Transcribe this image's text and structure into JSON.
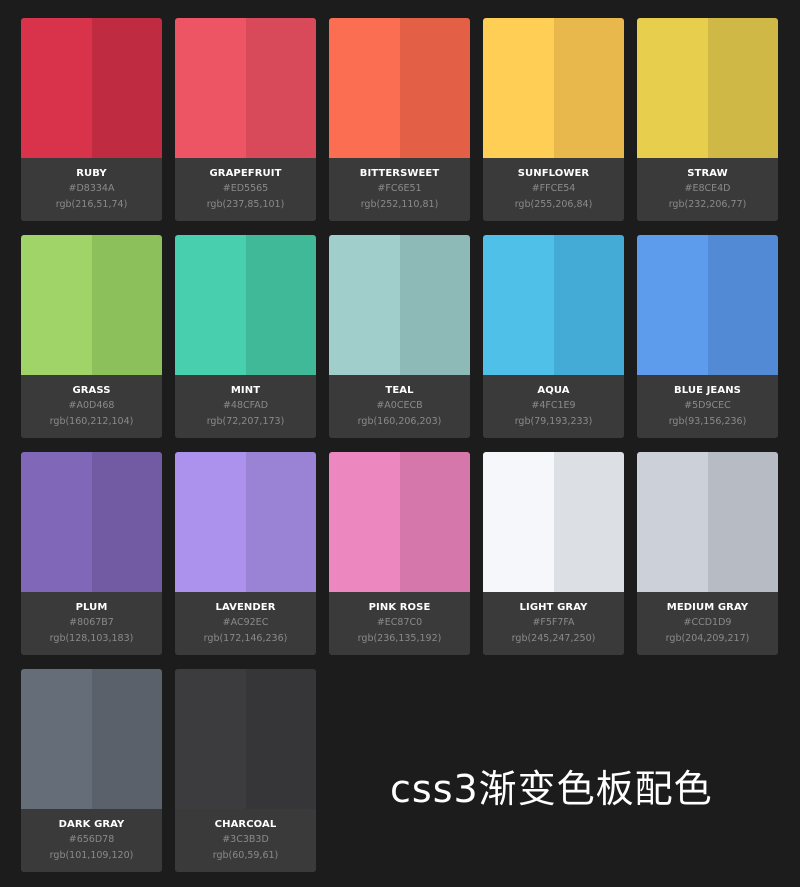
{
  "title": "css3渐变色板配色",
  "palette": [
    {
      "name": "RUBY",
      "hex": "#D8334A",
      "rgb": "rgb(216,51,74)",
      "light": "#D8334A",
      "dark": "#BF2B40"
    },
    {
      "name": "GRAPEFRUIT",
      "hex": "#ED5565",
      "rgb": "rgb(237,85,101)",
      "light": "#ED5565",
      "dark": "#D84A5A"
    },
    {
      "name": "BITTERSWEET",
      "hex": "#FC6E51",
      "rgb": "rgb(252,110,81)",
      "light": "#FC6E51",
      "dark": "#E35F46"
    },
    {
      "name": "SUNFLOWER",
      "hex": "#FFCE54",
      "rgb": "rgb(255,206,84)",
      "light": "#FFCE54",
      "dark": "#E8B84C"
    },
    {
      "name": "STRAW",
      "hex": "#E8CE4D",
      "rgb": "rgb(232,206,77)",
      "light": "#E8CE4D",
      "dark": "#CFB845"
    },
    {
      "name": "GRASS",
      "hex": "#A0D468",
      "rgb": "rgb(160,212,104)",
      "light": "#A0D468",
      "dark": "#8CC05B"
    },
    {
      "name": "MINT",
      "hex": "#48CFAD",
      "rgb": "rgb(72,207,173)",
      "light": "#48CFAD",
      "dark": "#3FB998"
    },
    {
      "name": "TEAL",
      "hex": "#A0CECB",
      "rgb": "rgb(160,206,203)",
      "light": "#A0CECB",
      "dark": "#8DB9B6"
    },
    {
      "name": "AQUA",
      "hex": "#4FC1E9",
      "rgb": "rgb(79,193,233)",
      "light": "#4FC1E9",
      "dark": "#44AAD6"
    },
    {
      "name": "BLUE JEANS",
      "hex": "#5D9CEC",
      "rgb": "rgb(93,156,236)",
      "light": "#5D9CEC",
      "dark": "#528AD6"
    },
    {
      "name": "PLUM",
      "hex": "#8067B7",
      "rgb": "rgb(128,103,183)",
      "light": "#8067B7",
      "dark": "#725BA3"
    },
    {
      "name": "LAVENDER",
      "hex": "#AC92EC",
      "rgb": "rgb(172,146,236)",
      "light": "#AC92EC",
      "dark": "#9A82D4"
    },
    {
      "name": "PINK ROSE",
      "hex": "#EC87C0",
      "rgb": "rgb(236,135,192)",
      "light": "#EC87C0",
      "dark": "#D677AB"
    },
    {
      "name": "LIGHT GRAY",
      "hex": "#F5F7FA",
      "rgb": "rgb(245,247,250)",
      "light": "#F5F7FA",
      "dark": "#DCDFE3"
    },
    {
      "name": "MEDIUM GRAY",
      "hex": "#CCD1D9",
      "rgb": "rgb(204,209,217)",
      "light": "#CCD1D9",
      "dark": "#B7BCC4"
    },
    {
      "name": "DARK GRAY",
      "hex": "#656D78",
      "rgb": "rgb(101,109,120)",
      "light": "#656D78",
      "dark": "#5A616B"
    },
    {
      "name": "CHARCOAL",
      "hex": "#3C3B3D",
      "rgb": "rgb(60,59,61)",
      "light": "#3C3B3D",
      "dark": "#363537"
    }
  ]
}
